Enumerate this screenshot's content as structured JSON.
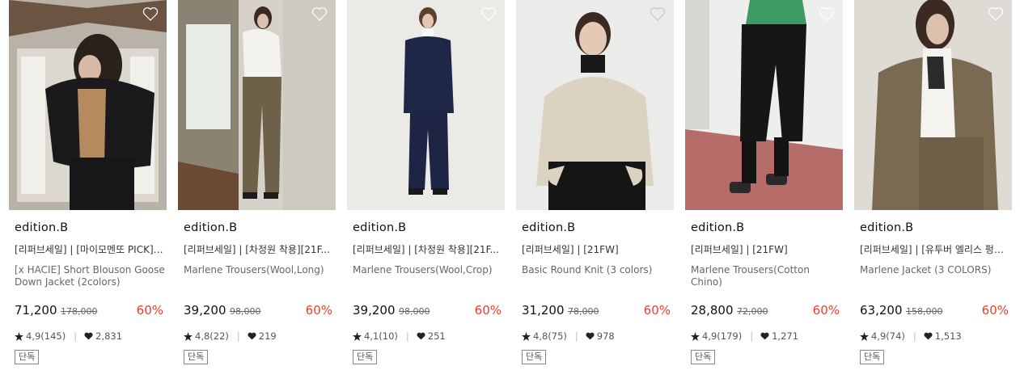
{
  "colors": {
    "discount": "#e8402c",
    "text": "#222222",
    "muted": "#666666"
  },
  "icons": {
    "wish": "heart-outline-icon",
    "rating": "star-icon",
    "likes": "heart-filled-icon"
  },
  "products": [
    {
      "brand": "edition.B",
      "tags": "[리퍼브세일] | [마이모멘또 PICK][...",
      "name": "[x HACIE] Short Blouson Goose Down Jacket (2colors)",
      "price": "71,200",
      "original_price": "178,000",
      "discount": "60%",
      "rating": "4,9(145)",
      "likes": "2,831",
      "badge": "단독"
    },
    {
      "brand": "edition.B",
      "tags": "[리퍼브세일] | [차정원 착용][21F...",
      "name": "Marlene Trousers(Wool,Long)",
      "price": "39,200",
      "original_price": "98,000",
      "discount": "60%",
      "rating": "4,8(22)",
      "likes": "219",
      "badge": "단독"
    },
    {
      "brand": "edition.B",
      "tags": "[리퍼브세일] | [차정원 착용][21F...",
      "name": "Marlene Trousers(Wool,Crop)",
      "price": "39,200",
      "original_price": "98,000",
      "discount": "60%",
      "rating": "4,1(10)",
      "likes": "251",
      "badge": "단독"
    },
    {
      "brand": "edition.B",
      "tags": "[리퍼브세일] | [21FW]",
      "name": "Basic Round Knit (3 colors)",
      "price": "31,200",
      "original_price": "78,000",
      "discount": "60%",
      "rating": "4,8(75)",
      "likes": "978",
      "badge": "단독"
    },
    {
      "brand": "edition.B",
      "tags": "[리퍼브세일] | [21FW]",
      "name": "Marlene Trousers(Cotton Chino)",
      "price": "28,800",
      "original_price": "72,000",
      "discount": "60%",
      "rating": "4,9(179)",
      "likes": "1,271",
      "badge": "단독"
    },
    {
      "brand": "edition.B",
      "tags": "[리퍼브세일] | [유투버 엘리스 펑크...",
      "name": "Marlene Jacket (3 COLORS)",
      "price": "63,200",
      "original_price": "158,000",
      "discount": "60%",
      "rating": "4,9(74)",
      "likes": "1,513",
      "badge": "단독"
    }
  ]
}
